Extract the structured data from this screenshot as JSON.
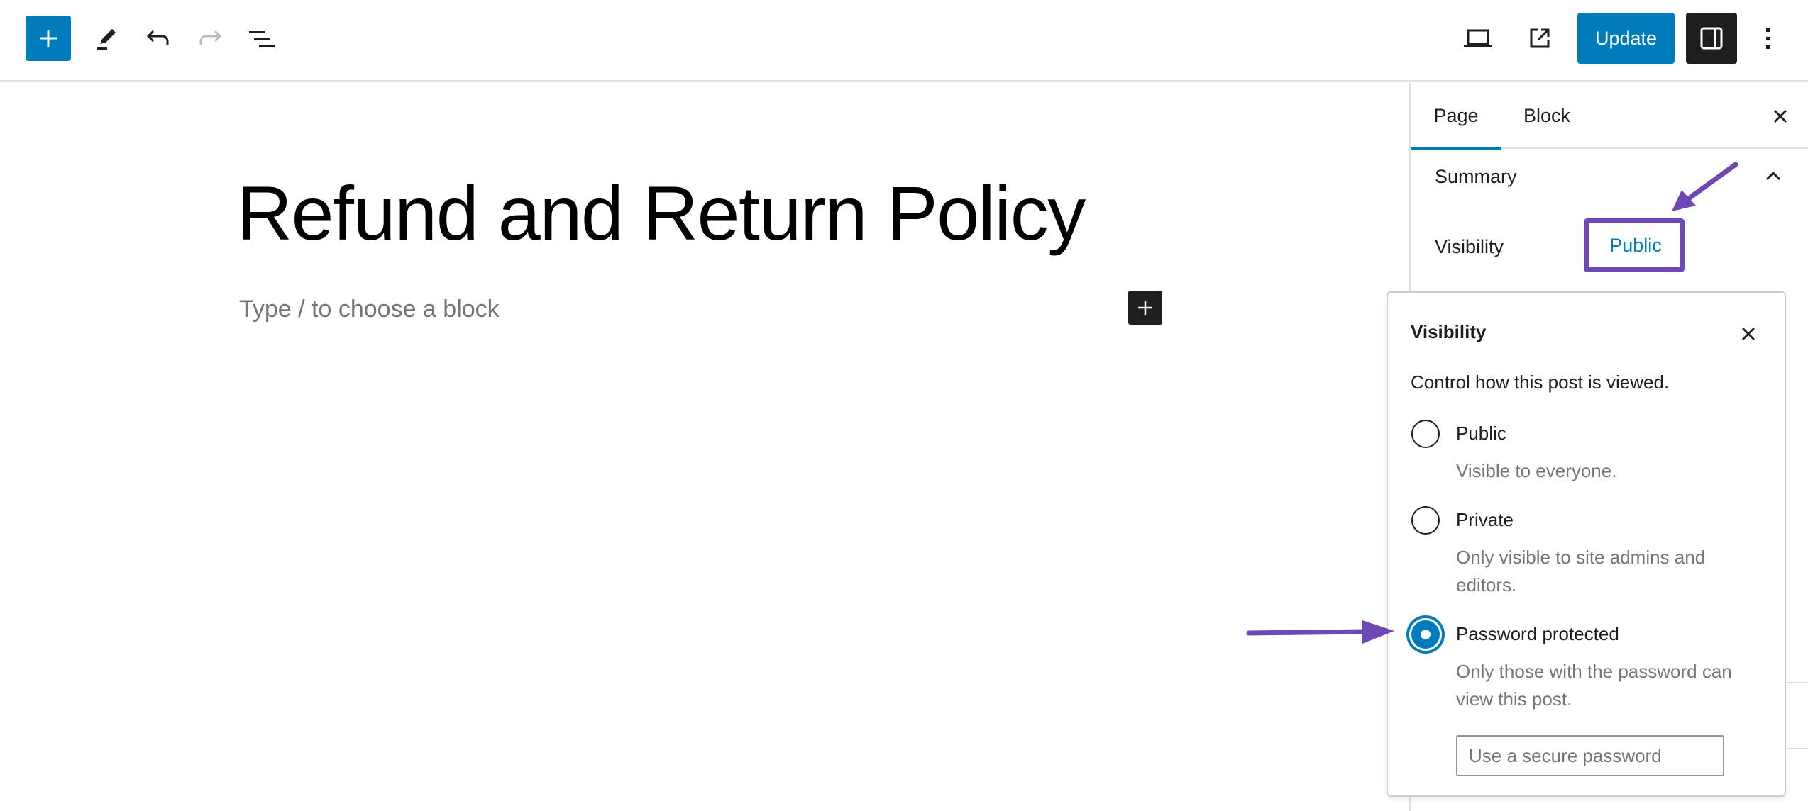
{
  "header": {
    "inserter_icon": "plus-icon",
    "tools_icon": "pencil-icon",
    "undo_icon": "undo-icon",
    "redo_icon": "redo-icon",
    "list_view_icon": "list-view-icon",
    "preview_icon": "laptop-icon",
    "view_page_icon": "external-link-icon",
    "update_label": "Update",
    "settings_icon": "sidebar-toggle-icon",
    "options_icon": "kebab-menu-icon"
  },
  "editor": {
    "title": "Refund and Return Policy",
    "block_placeholder": "Type / to choose a block",
    "inline_inserter_icon": "plus-icon"
  },
  "sidebar": {
    "tabs": [
      {
        "label": "Page",
        "active": true
      },
      {
        "label": "Block",
        "active": false
      }
    ],
    "close_icon": "close-icon",
    "summary": {
      "title": "Summary",
      "expanded": true,
      "visibility_label": "Visibility",
      "visibility_value": "Public"
    }
  },
  "visibility_popover": {
    "title": "Visibility",
    "description": "Control how this post is viewed.",
    "options": [
      {
        "label": "Public",
        "help": "Visible to everyone.",
        "checked": false
      },
      {
        "label": "Private",
        "help": "Only visible to site admins and editors.",
        "checked": false
      },
      {
        "label": "Password protected",
        "help": "Only those with the password can view this post.",
        "checked": true
      }
    ],
    "password_value": "",
    "password_placeholder": "Use a secure password"
  },
  "annotations": {
    "color": "#7048b6"
  },
  "colors": {
    "accent": "#007cba",
    "dark": "#1e1e1e",
    "muted": "#757575"
  }
}
